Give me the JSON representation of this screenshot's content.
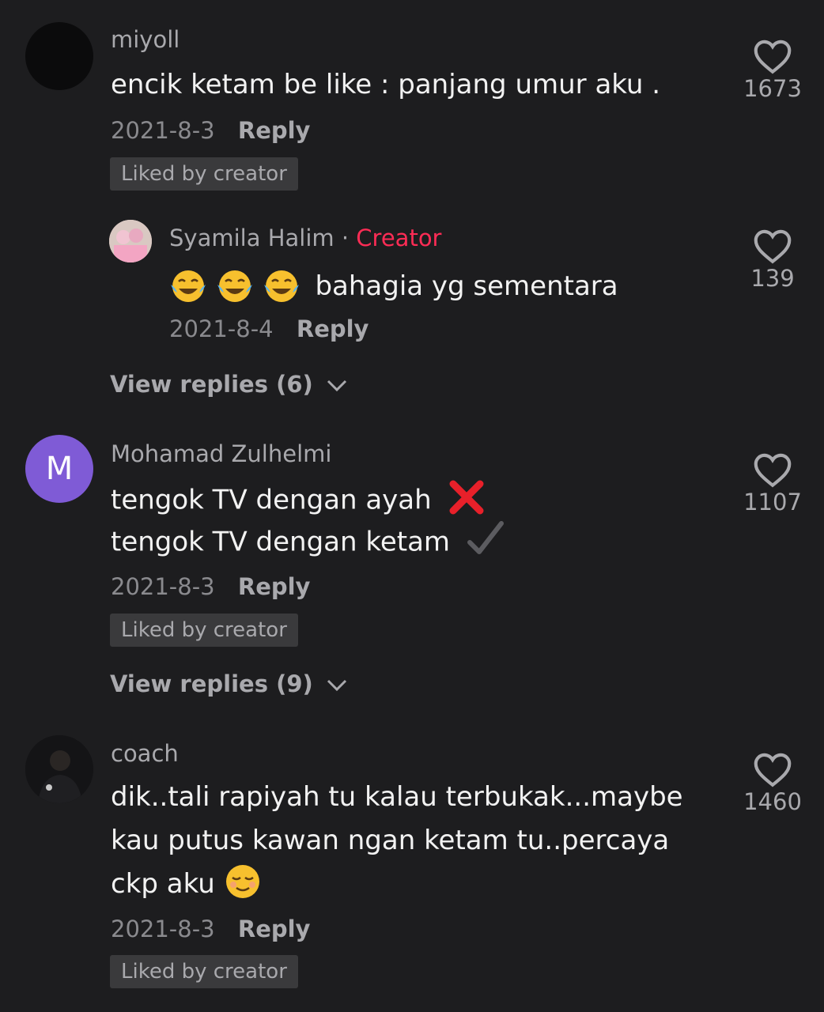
{
  "comments": [
    {
      "username": "miyoll",
      "text": "encik ketam be like : panjang umur aku .",
      "date": "2021-8-3",
      "reply_label": "Reply",
      "badge": "Liked by creator",
      "likes": "1673",
      "avatar_icon": "dark-photo-avatar"
    },
    {
      "username": "Mohamad Zulhelmi",
      "avatar_letter": "M",
      "avatar_color": "#7f5bd6",
      "text_line1": "tengok TV dengan ayah",
      "text_line2": "tengok TV dengan ketam",
      "date": "2021-8-3",
      "reply_label": "Reply",
      "badge": "Liked by creator",
      "likes": "1107",
      "view_replies": "View replies (9)"
    },
    {
      "username": "coach",
      "text_line1": "dik..tali rapiyah tu kalau terbukak...maybe",
      "text_line2": "kau putus kawan ngan ketam tu..percaya",
      "text_line3": "ckp aku",
      "date": "2021-8-3",
      "reply_label": "Reply",
      "badge": "Liked by creator",
      "likes": "1460"
    }
  ],
  "reply": {
    "username": "Syamila Halim",
    "separator": "·",
    "creator_label": "Creator",
    "text": "bahagia yg sementara",
    "date": "2021-8-4",
    "reply_label": "Reply",
    "likes": "139",
    "view_replies": "View replies (6)"
  },
  "colors": {
    "background": "#1d1d1f",
    "creator_accent": "#fe2c55",
    "cross": "#e8202a"
  }
}
